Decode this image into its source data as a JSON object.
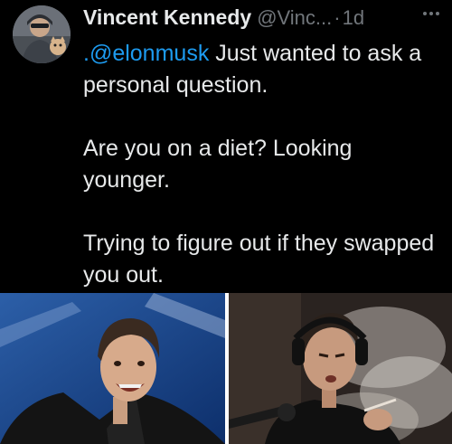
{
  "tweet": {
    "author_name": "Vincent Kennedy",
    "handle": "@Vinc...",
    "separator": "·",
    "time": "1d",
    "more_icon": "more-horizontal-icon",
    "mention": ".@elonmusk",
    "line1_rest": " Just wanted to ask a personal question.",
    "paragraph2": "Are you on a diet? Looking younger.",
    "paragraph3": "Trying to figure out if they swapped you out."
  },
  "colors": {
    "background": "#000000",
    "text": "#e7e9ea",
    "secondary_text": "#71767b",
    "mention": "#1d9bf0"
  }
}
